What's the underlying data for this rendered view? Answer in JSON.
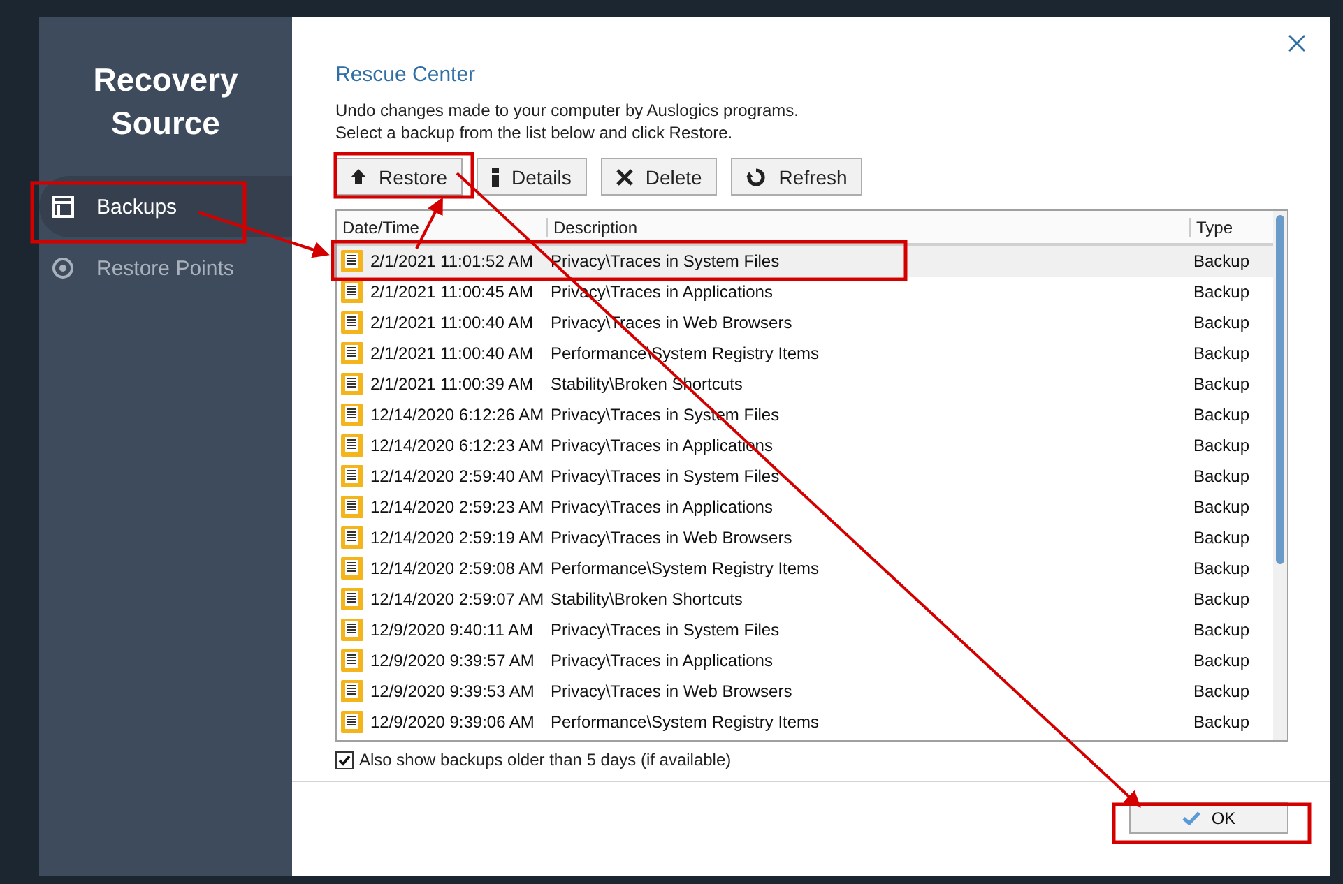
{
  "sidebar": {
    "title": "Recovery Source",
    "items": [
      {
        "label": "Backups",
        "selected": true
      },
      {
        "label": "Restore Points",
        "selected": false
      }
    ]
  },
  "panel": {
    "title": "Rescue Center",
    "description": [
      "Undo changes made to your computer by Auslogics programs.",
      "Select a backup from the list below and click Restore."
    ]
  },
  "toolbar": [
    {
      "label": "Restore"
    },
    {
      "label": "Details"
    },
    {
      "label": "Delete"
    },
    {
      "label": "Refresh"
    }
  ],
  "table": {
    "columns": [
      "Date/Time",
      "Description",
      "Type"
    ],
    "rows": [
      {
        "date": "2/1/2021 11:01:52 AM",
        "description": "Privacy\\Traces in System Files",
        "type": "Backup",
        "selected": true
      },
      {
        "date": "2/1/2021 11:00:45 AM",
        "description": "Privacy\\Traces in Applications",
        "type": "Backup",
        "selected": false
      },
      {
        "date": "2/1/2021 11:00:40 AM",
        "description": "Privacy\\Traces in Web Browsers",
        "type": "Backup",
        "selected": false
      },
      {
        "date": "2/1/2021 11:00:40 AM",
        "description": "Performance\\System Registry Items",
        "type": "Backup",
        "selected": false
      },
      {
        "date": "2/1/2021 11:00:39 AM",
        "description": "Stability\\Broken Shortcuts",
        "type": "Backup",
        "selected": false
      },
      {
        "date": "12/14/2020 6:12:26 AM",
        "description": "Privacy\\Traces in System Files",
        "type": "Backup",
        "selected": false
      },
      {
        "date": "12/14/2020 6:12:23 AM",
        "description": "Privacy\\Traces in Applications",
        "type": "Backup",
        "selected": false
      },
      {
        "date": "12/14/2020 2:59:40 AM",
        "description": "Privacy\\Traces in System Files",
        "type": "Backup",
        "selected": false
      },
      {
        "date": "12/14/2020 2:59:23 AM",
        "description": "Privacy\\Traces in Applications",
        "type": "Backup",
        "selected": false
      },
      {
        "date": "12/14/2020 2:59:19 AM",
        "description": "Privacy\\Traces in Web Browsers",
        "type": "Backup",
        "selected": false
      },
      {
        "date": "12/14/2020 2:59:08 AM",
        "description": "Performance\\System Registry Items",
        "type": "Backup",
        "selected": false
      },
      {
        "date": "12/14/2020 2:59:07 AM",
        "description": "Stability\\Broken Shortcuts",
        "type": "Backup",
        "selected": false
      },
      {
        "date": "12/9/2020 9:40:11 AM",
        "description": "Privacy\\Traces in System Files",
        "type": "Backup",
        "selected": false
      },
      {
        "date": "12/9/2020 9:39:57 AM",
        "description": "Privacy\\Traces in Applications",
        "type": "Backup",
        "selected": false
      },
      {
        "date": "12/9/2020 9:39:53 AM",
        "description": "Privacy\\Traces in Web Browsers",
        "type": "Backup",
        "selected": false
      },
      {
        "date": "12/9/2020 9:39:06 AM",
        "description": "Performance\\System Registry Items",
        "type": "Backup",
        "selected": false
      }
    ]
  },
  "option": {
    "label": "Also show backups older than 5 days (if available)",
    "checked": true
  },
  "ok_button": {
    "label": "OK"
  }
}
